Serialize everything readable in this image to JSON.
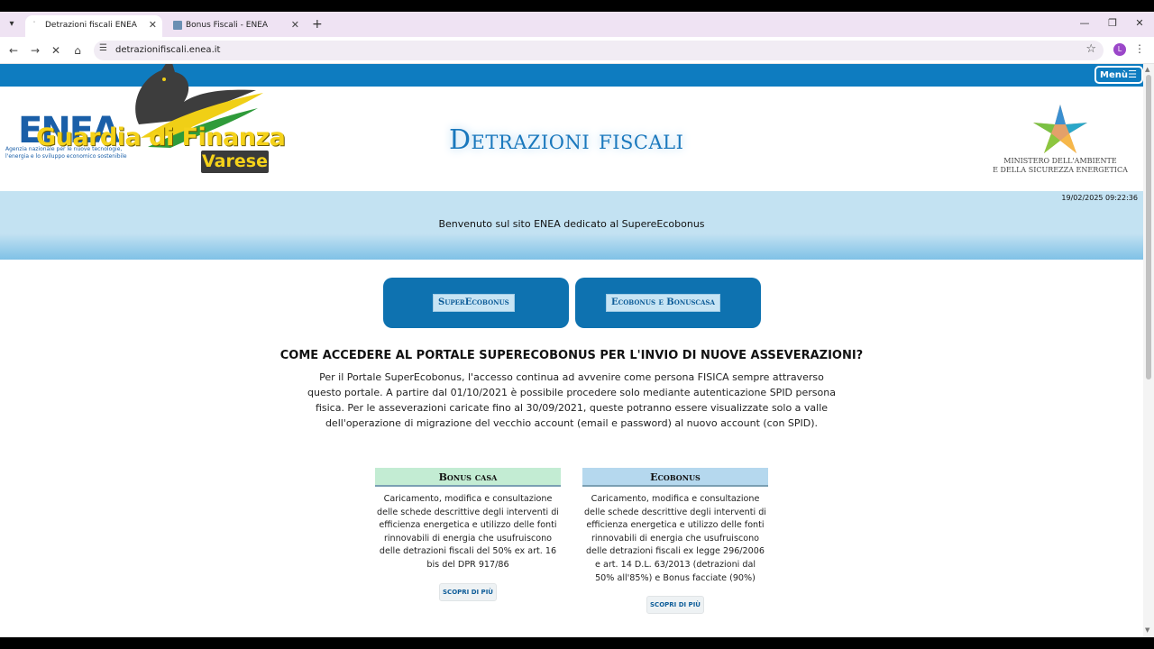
{
  "browser": {
    "tabs": [
      {
        "title": "Detrazioni fiscali ENEA",
        "active": true
      },
      {
        "title": "Bonus Fiscali - ENEA",
        "active": false
      }
    ],
    "new_tab": "+",
    "url": "detrazionifiscali.enea.it",
    "profile_initial": "L"
  },
  "site": {
    "menu_label": "Menù",
    "enea_logo": "ENEA",
    "enea_tagline": "Agenzia nazionale per le nuove tecnologie, l'energia e lo sviluppo economico sostenibile",
    "watermark_title": "Guardia di Finanza",
    "watermark_city": "Varese",
    "title": "Detrazioni fiscali",
    "ministry_line1": "MINISTERO DELL'AMBIENTE",
    "ministry_line2": "E DELLA SICUREZZA ENERGETICA"
  },
  "banner": {
    "datetime": "19/02/2025 09:22:36",
    "welcome": "Benvenuto sul sito ENEA dedicato al SupereEcobonus"
  },
  "buttons": {
    "superecobonus": "SuperEcobonus",
    "ecobonus_bonuscasa": "Ecobonus e Bonuscasa"
  },
  "access": {
    "title": "COME ACCEDERE AL PORTALE SUPERECOBONUS PER L'INVIO DI NUOVE ASSEVERAZIONI?",
    "body": "Per il Portale SuperEcobonus, l'accesso continua ad avvenire come persona FISICA sempre attraverso questo portale. A partire dal 01/10/2021 è possibile procedere solo mediante autenticazione SPID persona fisica. Per le asseverazioni caricate fino al 30/09/2021, queste potranno essere visualizzate solo a valle dell'operazione di migrazione del vecchio account (email e password) al nuovo account (con SPID)."
  },
  "cards": [
    {
      "title": "Bonus casa",
      "color": "#c3ecd3",
      "text": "Caricamento, modifica e consultazione delle schede descrittive degli interventi di efficienza energetica e utilizzo delle fonti rinnovabili di energia che usufruiscono delle detrazioni fiscali del 50% ex art. 16 bis del DPR 917/86",
      "more": "SCOPRI DI PIÙ"
    },
    {
      "title": "Ecobonus",
      "color": "#b5d8ee",
      "text": "Caricamento, modifica e consultazione delle schede descrittive degli interventi di efficienza energetica e utilizzo delle fonti rinnovabili di energia che usufruiscono delle detrazioni fiscali ex legge 296/2006 e art. 14 D.L. 63/2013 (detrazioni dal 50% all'85%) e Bonus facciate (90%)",
      "more": "SCOPRI DI PIÙ"
    }
  ]
}
